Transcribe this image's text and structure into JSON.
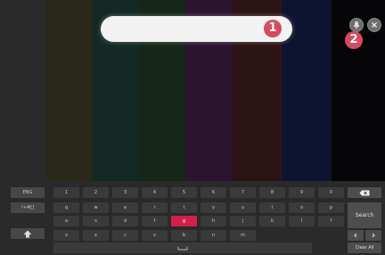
{
  "background_bars": [
    "#2a2a2a",
    "#2a2818",
    "#142826",
    "#16261a",
    "#2a1430",
    "#2c1416",
    "#0e1430",
    "#050508"
  ],
  "markers": {
    "m1": "1",
    "m2": "2"
  },
  "keyboard": {
    "row1": [
      "1",
      "2",
      "3",
      "4",
      "5",
      "6",
      "7",
      "8",
      "9",
      "0"
    ],
    "row2": [
      "q",
      "w",
      "e",
      "r",
      "t",
      "y",
      "u",
      "i",
      "o",
      "p"
    ],
    "row3": [
      "a",
      "s",
      "d",
      "f",
      "g",
      "h",
      "j",
      "k",
      "l",
      "?"
    ],
    "row4": [
      "z",
      "x",
      "c",
      "v",
      "b",
      "n",
      "m"
    ],
    "left": {
      "lang": "ENG",
      "symbols": "!+#[]"
    },
    "right": {
      "search": "Search",
      "clear_all": "Clear All"
    },
    "active_key": "g"
  }
}
